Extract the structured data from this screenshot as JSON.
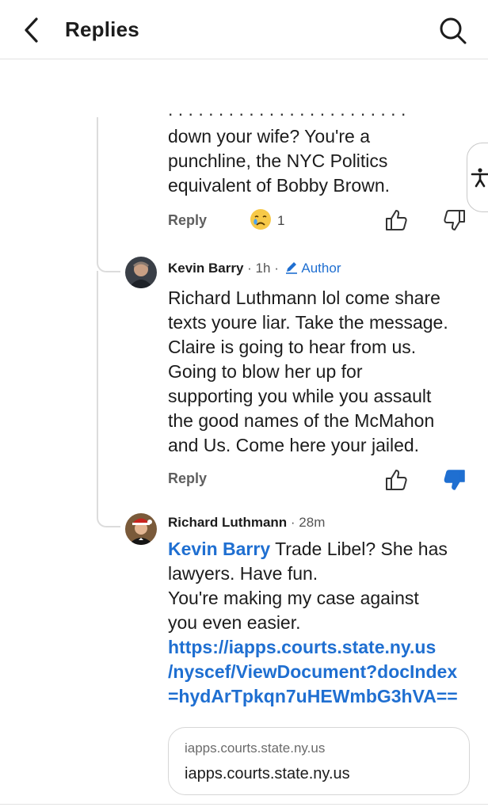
{
  "header": {
    "title": "Replies"
  },
  "comment_1": {
    "lines": [
      "down your wife? You're a",
      "punchline, the NYC Politics",
      "equivalent of Bobby Brown."
    ],
    "reply_label": "Reply",
    "reaction_count": "1"
  },
  "comment_2": {
    "author": "Kevin Barry",
    "time": "· 1h ·",
    "author_badge": "Author",
    "lines": [
      "Richard Luthmann lol come share",
      "texts youre liar. Take the message.",
      "Claire is going to hear from us.",
      "Going to blow her up for",
      "supporting you while you assault",
      "the good names of the McMahon",
      "and Us. Come here your jailed."
    ],
    "reply_label": "Reply"
  },
  "comment_3": {
    "author": "Richard Luthmann",
    "time": "· 28m",
    "mention": "Kevin Barry",
    "first_line_rest": " Trade Libel? She has",
    "lines": [
      "lawyers. Have fun.",
      "You're making my case against",
      "you even easier."
    ],
    "link_lines": [
      "https://iapps.courts.state.ny.us",
      "/nyscef/ViewDocument?docIndex",
      "=hydArTpkqn7uHEWmbG3hVA=="
    ],
    "link_card": {
      "domain": "iapps.courts.state.ny.us",
      "title": "iapps.courts.state.ny.us"
    }
  },
  "icons": [
    "back-arrow-icon",
    "search-icon",
    "thumbs-up-icon",
    "thumbs-down-icon",
    "crying-face-icon",
    "accessibility-icon",
    "pencil-icon"
  ],
  "colors": {
    "accent": "#1f6fd1",
    "text": "#1c1c1c",
    "muted": "#5f5f5f"
  }
}
